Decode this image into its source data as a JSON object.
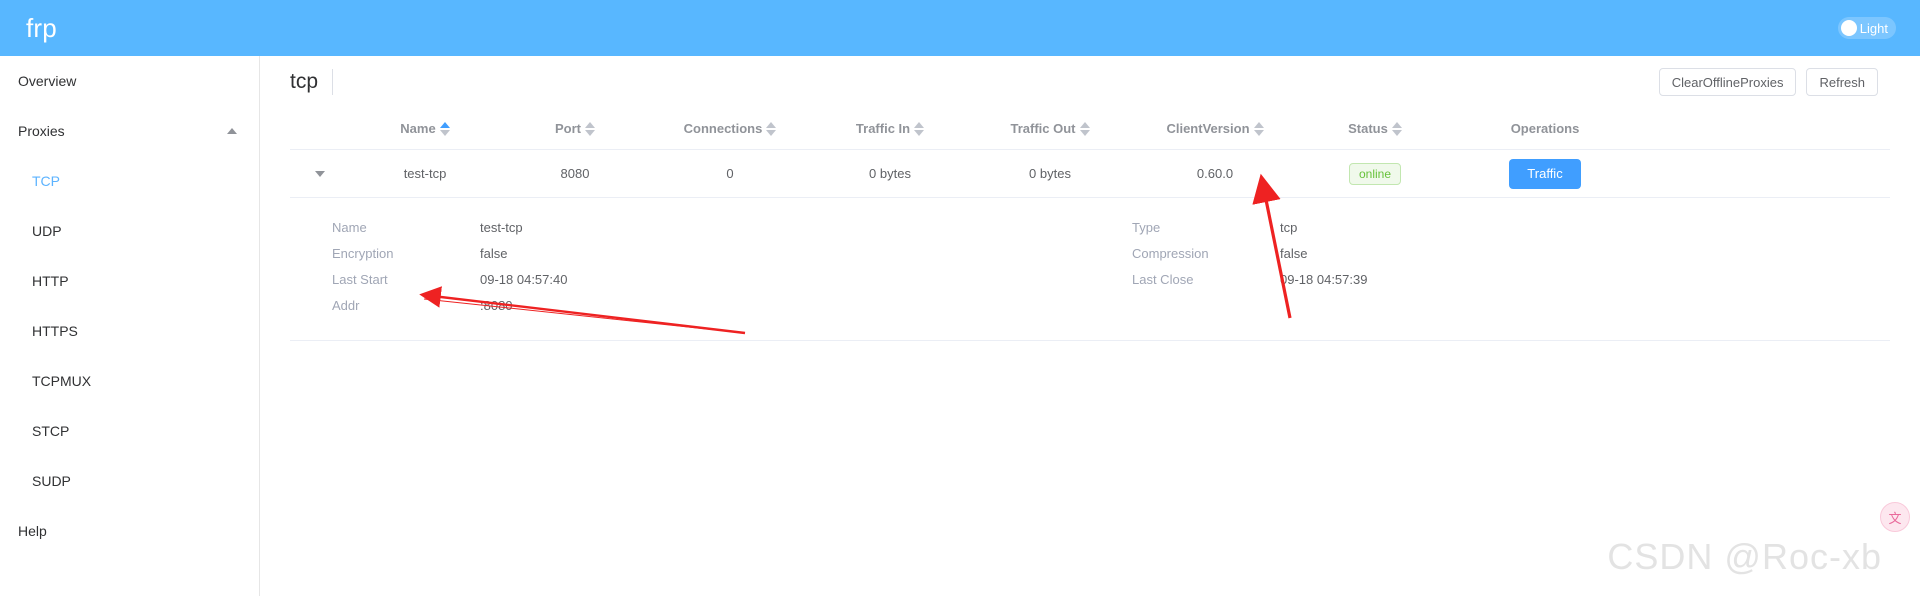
{
  "header": {
    "brand": "frp",
    "theme_toggle_label": "Light"
  },
  "sidebar": {
    "items": [
      {
        "label": "Overview",
        "type": "top",
        "active": false
      },
      {
        "label": "Proxies",
        "type": "group",
        "active": false
      },
      {
        "label": "TCP",
        "type": "child",
        "active": true
      },
      {
        "label": "UDP",
        "type": "child",
        "active": false
      },
      {
        "label": "HTTP",
        "type": "child",
        "active": false
      },
      {
        "label": "HTTPS",
        "type": "child",
        "active": false
      },
      {
        "label": "TCPMUX",
        "type": "child",
        "active": false
      },
      {
        "label": "STCP",
        "type": "child",
        "active": false
      },
      {
        "label": "SUDP",
        "type": "child",
        "active": false
      },
      {
        "label": "Help",
        "type": "top",
        "active": false
      }
    ]
  },
  "main": {
    "title": "tcp",
    "buttons": {
      "clear_offline": "ClearOfflineProxies",
      "refresh": "Refresh"
    },
    "table": {
      "headers": {
        "name": "Name",
        "port": "Port",
        "connections": "Connections",
        "traffic_in": "Traffic In",
        "traffic_out": "Traffic Out",
        "client_version": "ClientVersion",
        "status": "Status",
        "operations": "Operations"
      },
      "sort": {
        "column": "Name",
        "direction": "ascending"
      },
      "rows": [
        {
          "name": "test-tcp",
          "port": "8080",
          "connections": "0",
          "traffic_in": "0 bytes",
          "traffic_out": "0 bytes",
          "client_version": "0.60.0",
          "status": "online",
          "operation_label": "Traffic",
          "expanded": true
        }
      ]
    },
    "detail": {
      "left": [
        {
          "label": "Name",
          "value": "test-tcp"
        },
        {
          "label": "Encryption",
          "value": "false"
        },
        {
          "label": "Last Start",
          "value": "09-18 04:57:40"
        },
        {
          "label": "Addr",
          "value": ":8080"
        }
      ],
      "right": [
        {
          "label": "Type",
          "value": "tcp"
        },
        {
          "label": "Compression",
          "value": "false"
        },
        {
          "label": "Last Close",
          "value": "09-18 04:57:39"
        }
      ]
    }
  },
  "overlay": {
    "watermark": "CSDN @Roc-xb",
    "translate_fab_icon": "translate-icon"
  },
  "colors": {
    "brand_blue": "#58b7ff",
    "accent_blue": "#409eff",
    "status_green": "#67c23a",
    "annotation_red": "#ee2222"
  }
}
